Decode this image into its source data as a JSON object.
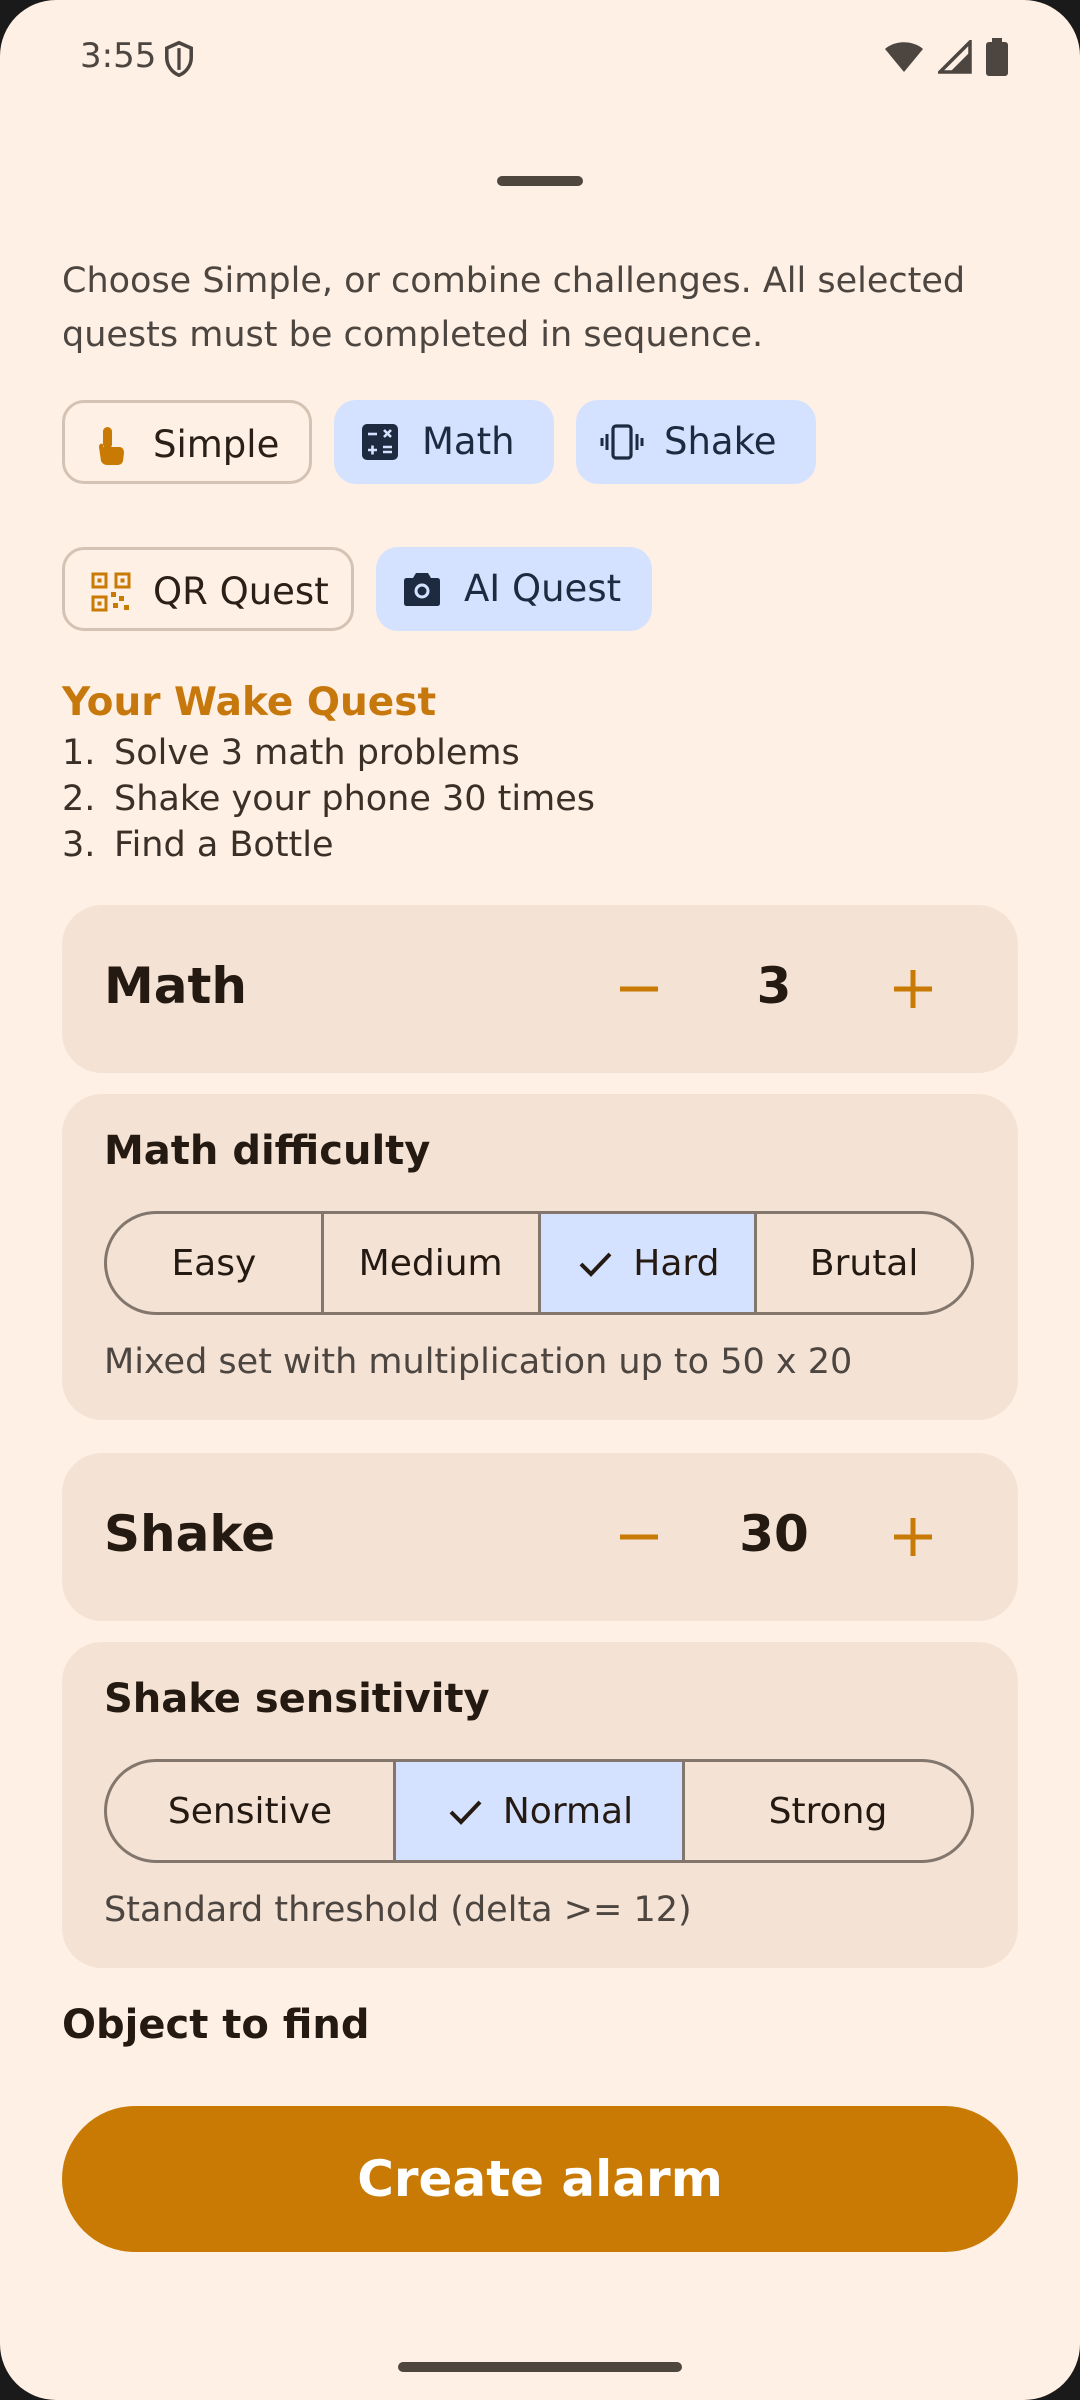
{
  "status_bar": {
    "time": "3:55"
  },
  "intro_text": "Choose Simple, or combine challenges. All selected quests must be completed in sequence.",
  "chips": [
    {
      "label": "Simple",
      "icon": "tap-hand-icon",
      "selected": false
    },
    {
      "label": "Math",
      "icon": "calculator-icon",
      "selected": true
    },
    {
      "label": "Shake",
      "icon": "vibrate-icon",
      "selected": true
    },
    {
      "label": "QR Quest",
      "icon": "qr-code-icon",
      "selected": false
    },
    {
      "label": "AI Quest",
      "icon": "camera-icon",
      "selected": true
    }
  ],
  "quest": {
    "title": "Your Wake Quest",
    "items": [
      {
        "num": "1.",
        "text": "Solve 3 math problems"
      },
      {
        "num": "2.",
        "text": "Shake your phone 30 times"
      },
      {
        "num": "3.",
        "text": "Find a Bottle"
      }
    ]
  },
  "math_stepper": {
    "title": "Math",
    "value": "3"
  },
  "math_difficulty": {
    "title": "Math difficulty",
    "options": [
      "Easy",
      "Medium",
      "Hard",
      "Brutal"
    ],
    "selected": "Hard",
    "description": "Mixed set with multiplication up to 50 x 20"
  },
  "shake_stepper": {
    "title": "Shake",
    "value": "30"
  },
  "shake_sensitivity": {
    "title": "Shake sensitivity",
    "options": [
      "Sensitive",
      "Normal",
      "Strong"
    ],
    "selected": "Normal",
    "description": "Standard threshold (delta >= 12)"
  },
  "object_label": "Object to find",
  "create_button": "Create alarm",
  "colors": {
    "background": "#fef0e4",
    "accent": "#c87a04",
    "selected_chip": "#d5e2ff",
    "card": "#f4e3d5"
  }
}
